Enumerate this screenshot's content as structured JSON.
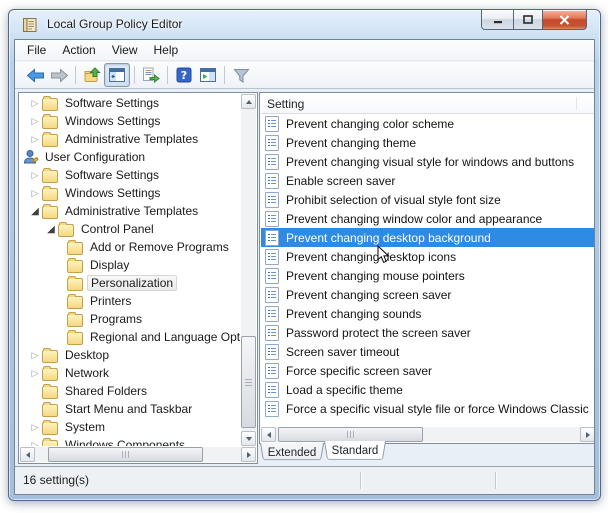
{
  "window": {
    "title": "Local Group Policy Editor"
  },
  "window_controls": {
    "icons": [
      "minimize-icon",
      "maximize-icon",
      "close-icon"
    ]
  },
  "menu": {
    "items": [
      {
        "label": "File"
      },
      {
        "label": "Action"
      },
      {
        "label": "View"
      },
      {
        "label": "Help"
      }
    ]
  },
  "toolbar": {
    "buttons": [
      {
        "icon": "back-arrow"
      },
      {
        "icon": "forward-arrow"
      },
      {
        "icon": "up-one-level-folder"
      },
      {
        "icon": "show-console-tree",
        "pressed": true
      },
      {
        "icon": "export-list"
      },
      {
        "icon": "help"
      },
      {
        "icon": "show-action-pane"
      },
      {
        "icon": "filter"
      }
    ]
  },
  "tree": {
    "items": [
      {
        "label": "Software Settings",
        "level": 1,
        "state": "collapsed",
        "icon": "folder"
      },
      {
        "label": "Windows Settings",
        "level": 1,
        "state": "collapsed",
        "icon": "folder"
      },
      {
        "label": "Administrative Templates",
        "level": 1,
        "state": "collapsed",
        "icon": "folder"
      },
      {
        "label": "User Configuration",
        "level": 0,
        "state": "none",
        "icon": "user"
      },
      {
        "label": "Software Settings",
        "level": 1,
        "state": "collapsed",
        "icon": "folder"
      },
      {
        "label": "Windows Settings",
        "level": 1,
        "state": "collapsed",
        "icon": "folder"
      },
      {
        "label": "Administrative Templates",
        "level": 1,
        "state": "expanded",
        "icon": "folder"
      },
      {
        "label": "Control Panel",
        "level": 2,
        "state": "expanded",
        "icon": "folder"
      },
      {
        "label": "Add or Remove Programs",
        "level": 3,
        "state": "none",
        "icon": "folder"
      },
      {
        "label": "Display",
        "level": 3,
        "state": "none",
        "icon": "folder"
      },
      {
        "label": "Personalization",
        "level": 3,
        "state": "none",
        "icon": "folder",
        "selected": true
      },
      {
        "label": "Printers",
        "level": 3,
        "state": "none",
        "icon": "folder"
      },
      {
        "label": "Programs",
        "level": 3,
        "state": "none",
        "icon": "folder"
      },
      {
        "label": "Regional and Language Options",
        "level": 3,
        "state": "none",
        "icon": "folder"
      },
      {
        "label": "Desktop",
        "level": 1,
        "state": "collapsed",
        "icon": "folder"
      },
      {
        "label": "Network",
        "level": 1,
        "state": "collapsed",
        "icon": "folder"
      },
      {
        "label": "Shared Folders",
        "level": 1,
        "state": "none",
        "icon": "folder"
      },
      {
        "label": "Start Menu and Taskbar",
        "level": 1,
        "state": "none",
        "icon": "folder"
      },
      {
        "label": "System",
        "level": 1,
        "state": "collapsed",
        "icon": "folder"
      },
      {
        "label": "Windows Components",
        "level": 1,
        "state": "collapsed",
        "icon": "folder"
      }
    ]
  },
  "list": {
    "header": "Setting",
    "selected": "Prevent changing desktop background",
    "items": [
      "Prevent changing color scheme",
      "Prevent changing theme",
      "Prevent changing visual style for windows and buttons",
      "Enable screen saver",
      "Prohibit selection of visual style font size",
      "Prevent changing window color and appearance",
      "Prevent changing desktop background",
      "Prevent changing desktop icons",
      "Prevent changing mouse pointers",
      "Prevent changing screen saver",
      "Prevent changing sounds",
      "Password protect the screen saver",
      "Screen saver timeout",
      "Force specific screen saver",
      "Load a specific theme",
      "Force a specific visual style file or force Windows Classic"
    ]
  },
  "tabs": {
    "items": [
      {
        "label": "Extended"
      },
      {
        "label": "Standard",
        "active": true
      }
    ]
  },
  "statusbar": {
    "text": "16 setting(s)"
  },
  "colors": {
    "selection": "#2e8be4",
    "close_button": "#c6492a",
    "frame": "#b9d2ea",
    "folder": "#f5d87f"
  }
}
